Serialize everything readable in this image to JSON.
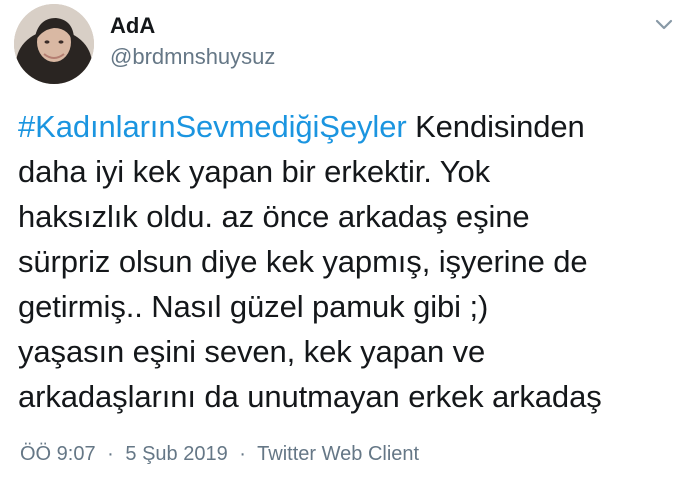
{
  "user": {
    "display_name": "AdA",
    "handle": "@brdmnshuysuz"
  },
  "icons": {
    "avatar": "profile-photo",
    "menu": "chevron-down-icon"
  },
  "tweet": {
    "hashtag": "#KadınlarınSevmediğiŞeyler",
    "text_after_hashtag": " Kendisinden\ndaha iyi kek yapan bir erkektir. Yok\nhaksızlık oldu. az önce arkadaş eşine\nsürpriz olsun diye kek yapmış, işyerine de\ngetirmiş.. Nasıl güzel pamuk gibi ;)\nyaşasın eşini seven, kek yapan ve\narkadaşlarını da unutmayan erkek arkadaş"
  },
  "meta": {
    "time": "ÖÖ 9:07",
    "separator": "·",
    "date": "5 Şub 2019",
    "client": "Twitter Web Client"
  },
  "colors": {
    "link": "#1b95e0",
    "secondary_text": "#657786",
    "primary_text": "#14171a"
  }
}
